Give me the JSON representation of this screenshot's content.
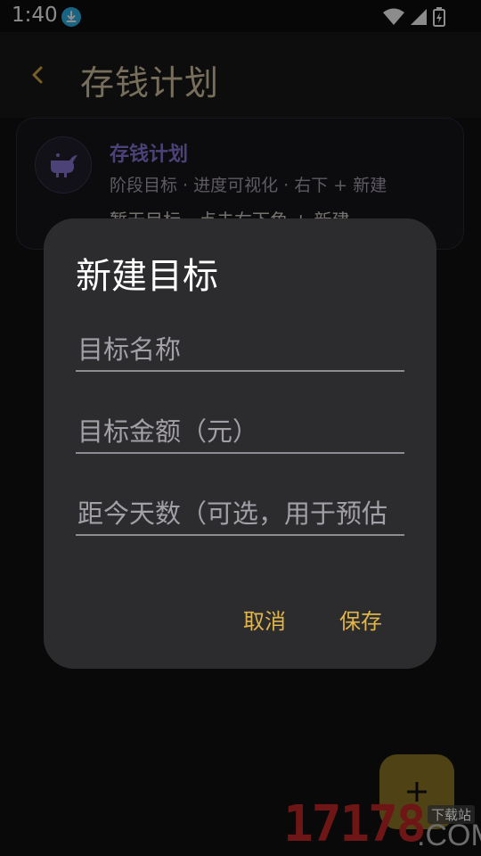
{
  "status_bar": {
    "time": "1:40"
  },
  "header": {
    "title": "存钱计划"
  },
  "card": {
    "title": "存钱计划",
    "subtitle": "阶段目标 · 进度可视化 · 右下 + 新建",
    "hint": "暂无目标，点击右下角 + 新建"
  },
  "dialog": {
    "title": "新建目标",
    "fields": [
      {
        "placeholder": "目标名称",
        "value": ""
      },
      {
        "placeholder": "目标金额（元）",
        "value": ""
      },
      {
        "placeholder": "距今天数（可选，用于预估",
        "value": ""
      }
    ],
    "cancel_label": "取消",
    "save_label": "保存"
  },
  "fab": {
    "label": "+"
  },
  "watermark": {
    "brand": "17178",
    "domain": ".COM",
    "tag": "下载站"
  },
  "colors": {
    "accent": "#e0b54a",
    "card_title": "#8a79d9",
    "header_title": "#d9c9a6",
    "fab": "#c8a430"
  }
}
